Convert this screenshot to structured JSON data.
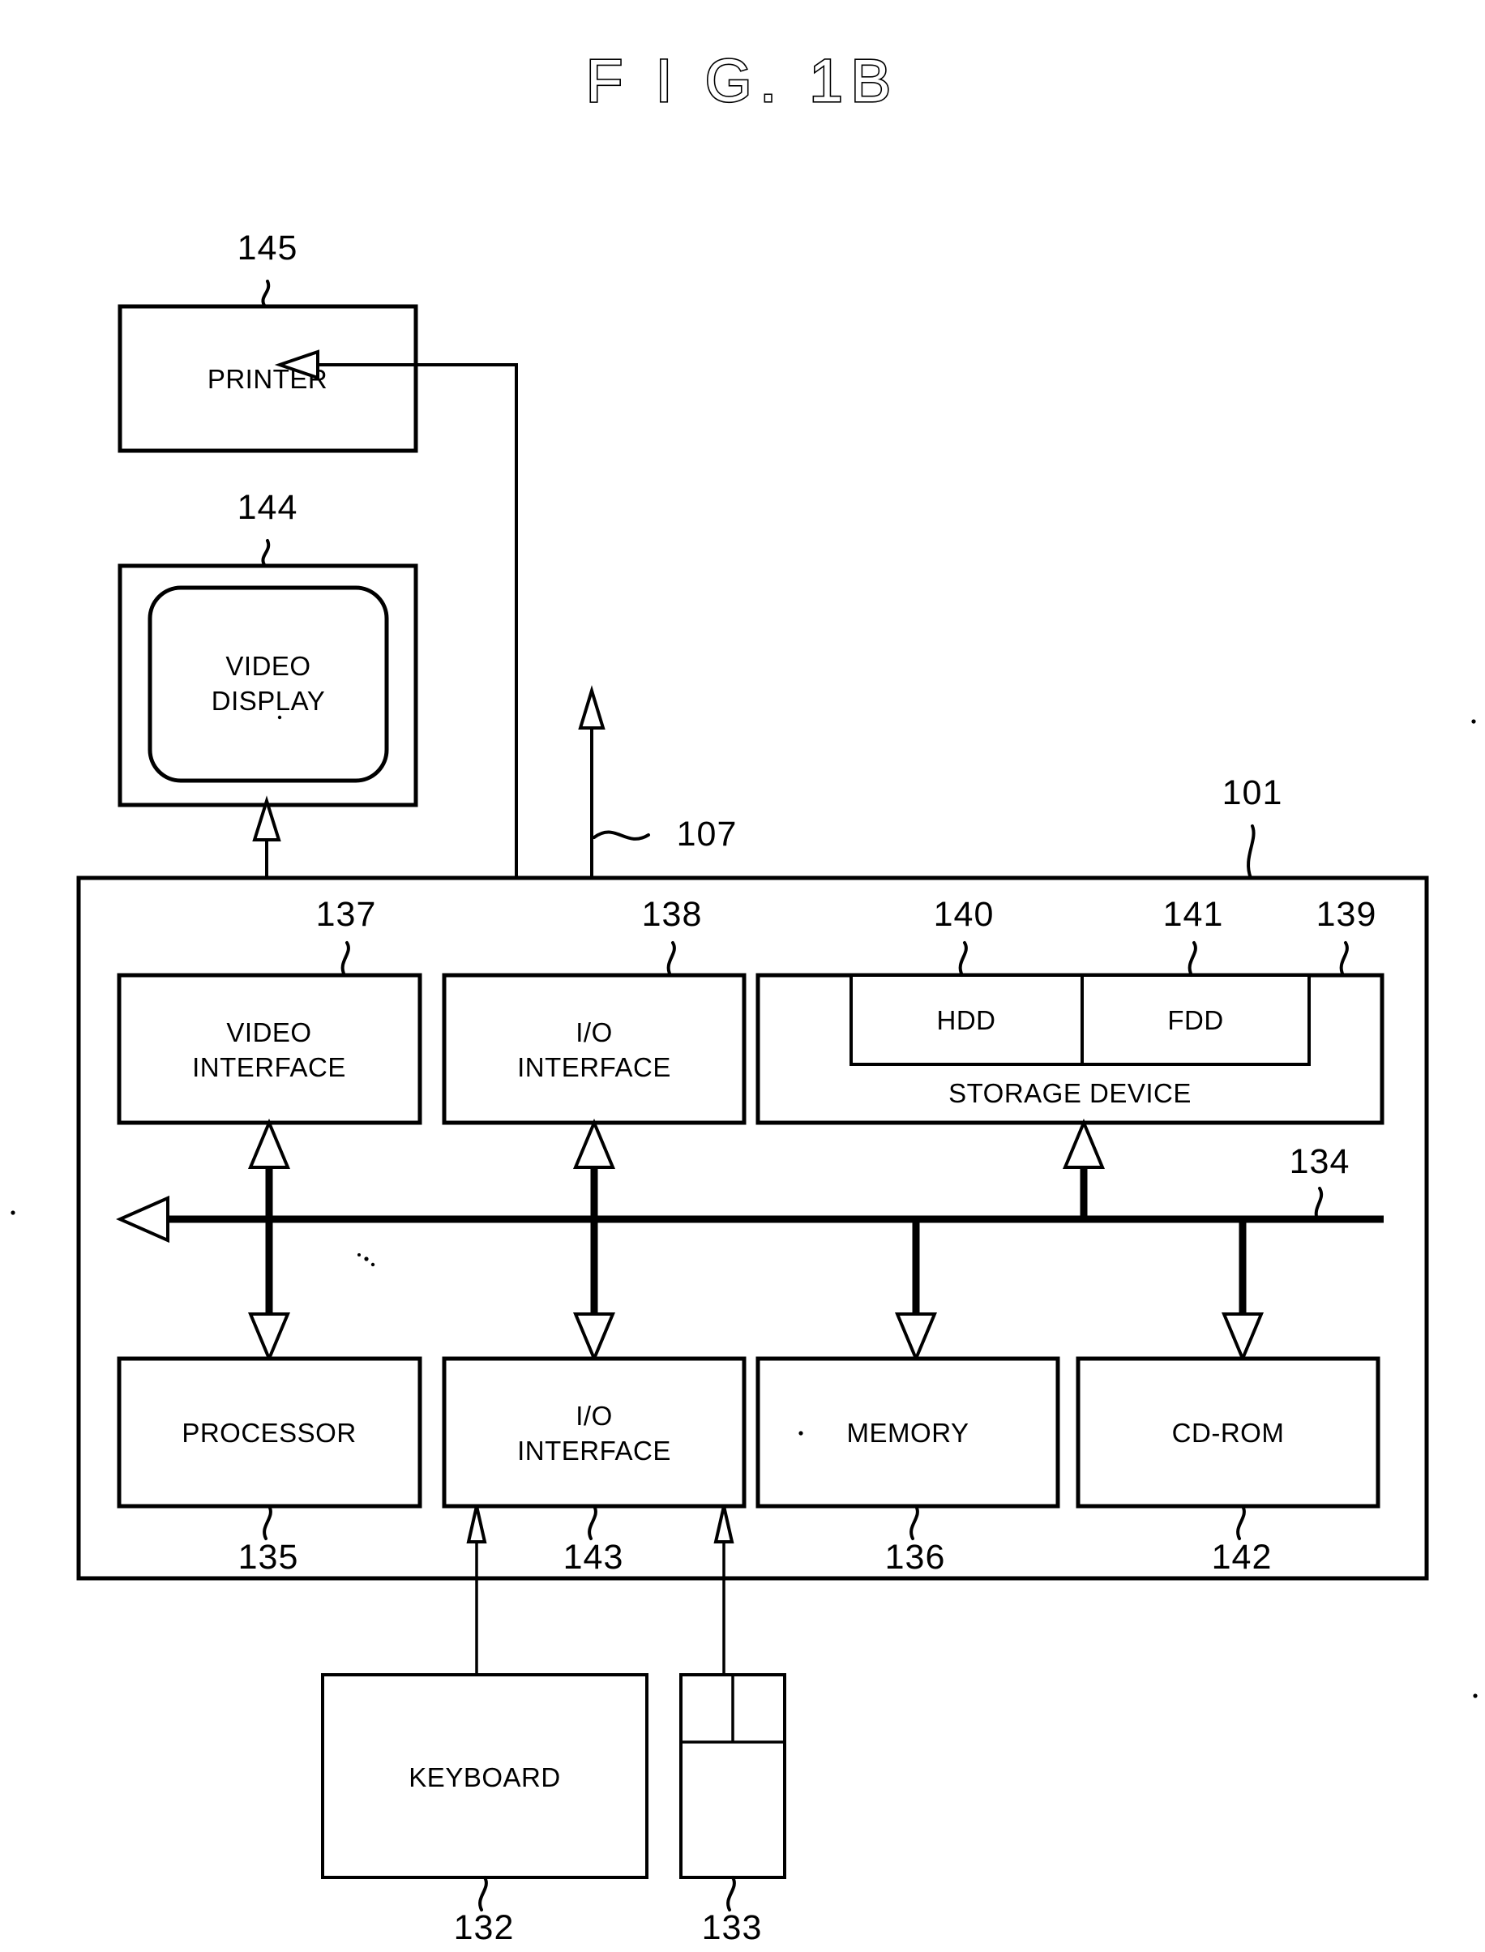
{
  "figure": {
    "title": "F I G.  1B",
    "type": "patent-block-diagram"
  },
  "blocks": [
    {
      "id": "printer",
      "label": "PRINTER",
      "ref": "145"
    },
    {
      "id": "video-display",
      "label": "VIDEO\nDISPLAY",
      "ref": "144"
    },
    {
      "id": "video-interface",
      "label": "VIDEO\nINTERFACE",
      "ref": "137"
    },
    {
      "id": "io-interface-top",
      "label": "I/O\nINTERFACE",
      "ref": "138"
    },
    {
      "id": "storage-device",
      "label": "STORAGE DEVICE",
      "ref": "139"
    },
    {
      "id": "hdd",
      "label": "HDD",
      "ref": "140"
    },
    {
      "id": "fdd",
      "label": "FDD",
      "ref": "141"
    },
    {
      "id": "processor",
      "label": "PROCESSOR",
      "ref": "135"
    },
    {
      "id": "io-interface-bot",
      "label": "I/O\nINTERFACE",
      "ref": "143"
    },
    {
      "id": "memory",
      "label": "MEMORY",
      "ref": "136"
    },
    {
      "id": "cdrom",
      "label": "CD-ROM",
      "ref": "142"
    },
    {
      "id": "keyboard",
      "label": "KEYBOARD",
      "ref": "132"
    },
    {
      "id": "mouse",
      "label": "",
      "ref": "133"
    }
  ],
  "labels": {
    "printer": "PRINTER",
    "video_display_line1": "VIDEO",
    "video_display_line2": "DISPLAY",
    "video_interface_line1": "VIDEO",
    "video_interface_line2": "INTERFACE",
    "io_interface_top_line1": "I/O",
    "io_interface_top_line2": "INTERFACE",
    "storage_device": "STORAGE DEVICE",
    "hdd": "HDD",
    "fdd": "FDD",
    "processor": "PROCESSOR",
    "io_interface_bot_line1": "I/O",
    "io_interface_bot_line2": "INTERFACE",
    "memory": "MEMORY",
    "cdrom": "CD-ROM",
    "keyboard": "KEYBOARD"
  },
  "refs": {
    "system_unit": "101",
    "external_bus": "107",
    "internal_bus": "134",
    "processor": "135",
    "memory": "136",
    "video_interface": "137",
    "io_interface_top": "138",
    "storage_device": "139",
    "hdd": "140",
    "fdd": "141",
    "cdrom": "142",
    "io_interface_bot": "143",
    "video_display": "144",
    "printer": "145",
    "keyboard": "132",
    "mouse": "133"
  },
  "colors": {
    "ink": "#000000",
    "paper": "#ffffff"
  }
}
